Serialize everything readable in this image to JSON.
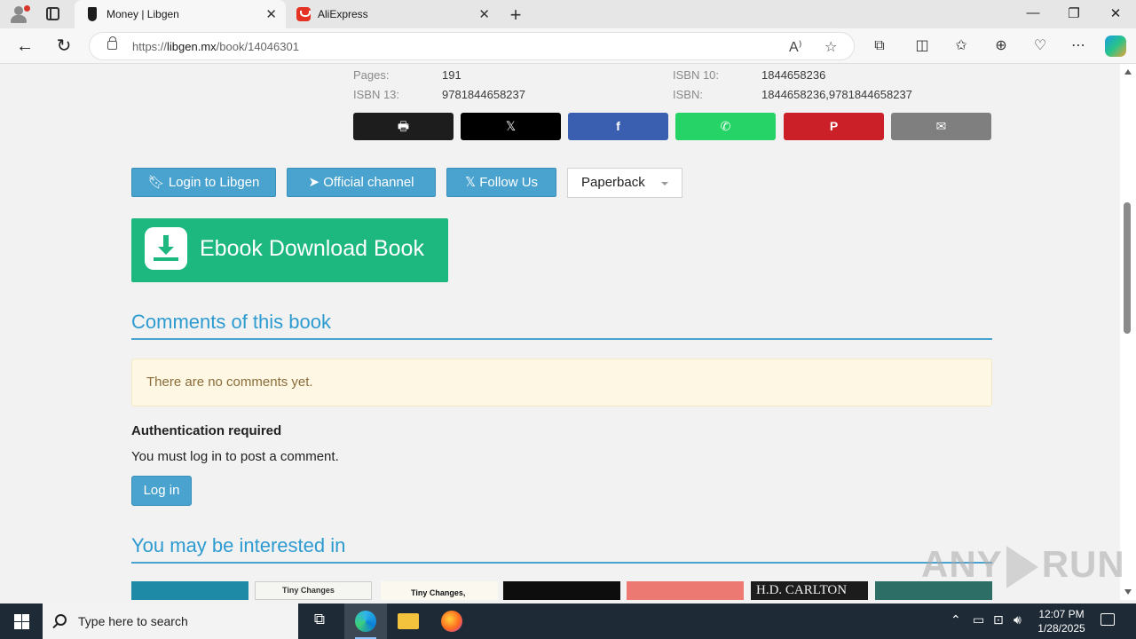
{
  "browser": {
    "tabs": [
      {
        "title": "Money | Libgen",
        "active": true
      },
      {
        "title": "AliExpress",
        "active": false
      }
    ],
    "url_prefix": "https://",
    "url_domain": "libgen.mx",
    "url_path": "/book/14046301"
  },
  "book_meta": {
    "pages_label": "Pages:",
    "pages_value": "191",
    "isbn13_label": "ISBN 13:",
    "isbn13_value": "9781844658237",
    "isbn10_label": "ISBN 10:",
    "isbn10_value": "1844658236",
    "isbn_label": "ISBN:",
    "isbn_value": "1844658236,9781844658237"
  },
  "share_buttons": [
    {
      "name": "print",
      "glyph": "🖶",
      "color": "#1d1d1d"
    },
    {
      "name": "x",
      "glyph": "𝕏",
      "color": "#000000"
    },
    {
      "name": "facebook",
      "glyph": "f",
      "color": "#3b5fb0"
    },
    {
      "name": "whatsapp",
      "glyph": "✆",
      "color": "#25d366"
    },
    {
      "name": "pinterest",
      "glyph": "P",
      "color": "#cb2027"
    },
    {
      "name": "email",
      "glyph": "✉",
      "color": "#7f7f7f"
    }
  ],
  "actions": {
    "login_libgen": "Login to Libgen",
    "official_channel": "Official channel",
    "follow_us": "Follow Us",
    "format_select": "Paperback"
  },
  "ebook_button": "Ebook Download Book",
  "comments": {
    "title": "Comments of this book",
    "empty_notice": "There are no comments yet.",
    "auth_title": "Authentication required",
    "auth_text": "You must log in to post a comment.",
    "login_button": "Log in"
  },
  "related": {
    "title": "You may be interested in",
    "thumb_texts": [
      "",
      "Tiny Changes",
      "Tiny Changes,",
      "",
      "",
      "H.D. CARLTON",
      ""
    ]
  },
  "watermark": {
    "left": "ANY",
    "right": "RUN"
  },
  "taskbar": {
    "search_placeholder": "Type here to search",
    "time": "12:07 PM",
    "date": "1/28/2025"
  }
}
